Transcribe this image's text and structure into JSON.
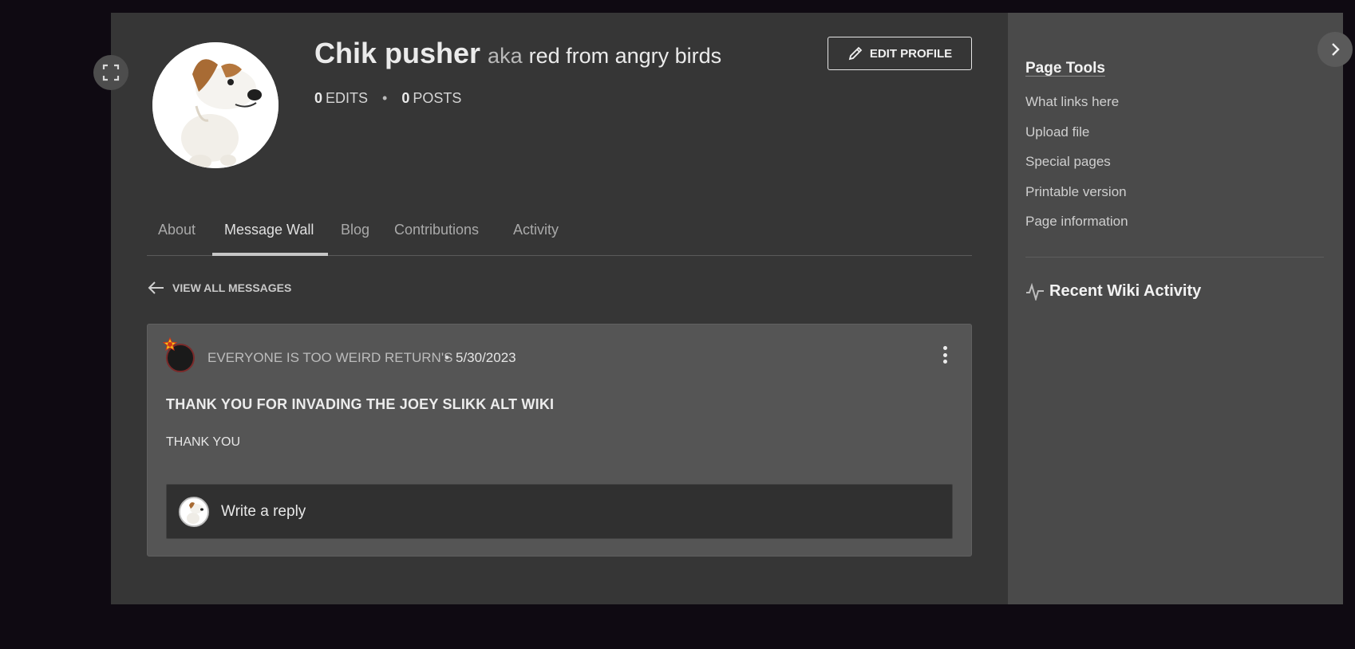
{
  "profile": {
    "username": "Chik pusher",
    "aka_prefix": "aka",
    "aka_text": "red from angry birds",
    "edits_count": "0",
    "edits_label": "EDITS",
    "posts_count": "0",
    "posts_label": "POSTS",
    "edit_button_label": "EDIT PROFILE"
  },
  "tabs": [
    {
      "label": "About",
      "active": false
    },
    {
      "label": "Message Wall",
      "active": true
    },
    {
      "label": "Blog",
      "active": false
    },
    {
      "label": "Contributions",
      "active": false
    },
    {
      "label": "Activity",
      "active": false
    }
  ],
  "view_all_label": "VIEW ALL MESSAGES",
  "message": {
    "author": "EVERYONE IS TOO WEIRD RETURN'S",
    "separator": "•",
    "date": "5/30/2023",
    "title": "THANK YOU FOR INVADING THE JOEY SLIKK ALT WIKI",
    "body": "THANK YOU",
    "reply_placeholder": "Write a reply"
  },
  "rail": {
    "page_tools_title": "Page Tools",
    "tools": [
      "What links here",
      "Upload file",
      "Special pages",
      "Printable version",
      "Page information"
    ],
    "recent_activity_title": "Recent Wiki Activity"
  },
  "icons": {
    "expand": "expand-icon",
    "rail_toggle": "chevron-right-icon",
    "edit": "pencil-icon",
    "back": "arrow-left-icon",
    "more": "kebab-menu-icon",
    "activity": "activity-pulse-icon"
  }
}
